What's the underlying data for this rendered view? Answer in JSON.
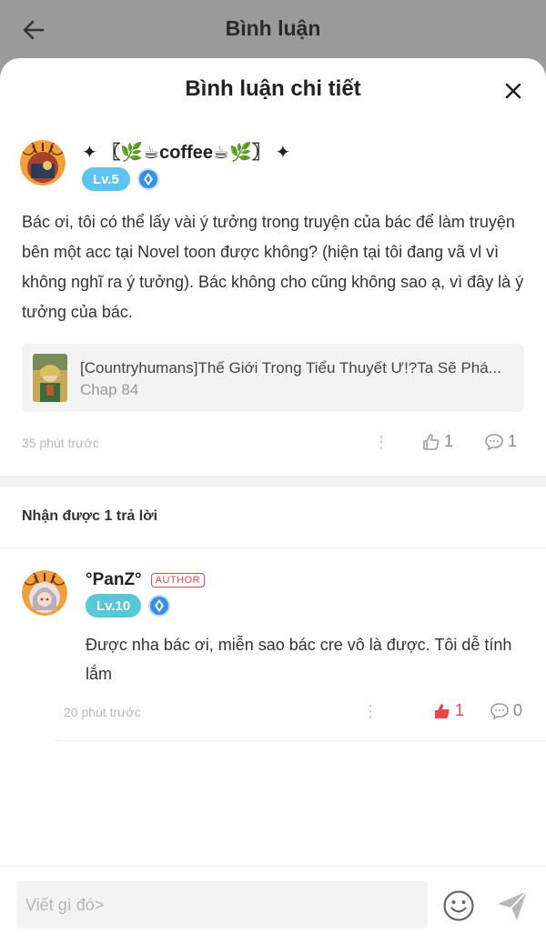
{
  "appbar": {
    "title": "Bình luận",
    "back_icon": "arrow-left-icon"
  },
  "sheet": {
    "title": "Bình luận chi tiết",
    "close_icon": "close-icon"
  },
  "main_comment": {
    "username": "✦ 〖🌿☕coffee☕🌿〗 ✦",
    "level": "Lv.5",
    "text": "Bác ơi, tôi có thể lấy vài ý tưởng trong truyện của bác để làm truyện bên một acc tại Novel toon được không? (hiện tại tôi đang vã vl vì không nghĩ ra ý tưởng). Bác không cho cũng không sao ạ, vì đây là ý tưởng của bác.",
    "story": {
      "title": "[Countryhumans]Thế Giới Trong Tiểu Thuyết Ư!?Ta Sẽ Phá...",
      "chapter": "Chap 84"
    },
    "time": "35 phút trước",
    "likes": "1",
    "replies": "1"
  },
  "reply_section": {
    "label": "Nhận được 1 trả lời"
  },
  "reply": {
    "username": "°PanZ°",
    "author_tag": "AUTHOR",
    "level": "Lv.10",
    "text": "Được nha bác ơi, miễn sao bác cre vô là được. Tôi dễ tính lắm",
    "time": "20 phút trước",
    "likes": "1",
    "replies": "0"
  },
  "composer": {
    "placeholder": "Viết gì đó>"
  },
  "colors": {
    "accent_red": "#e8474c",
    "level_blue": "#5cc4ee",
    "verify_blue": "#3a8ee6"
  }
}
